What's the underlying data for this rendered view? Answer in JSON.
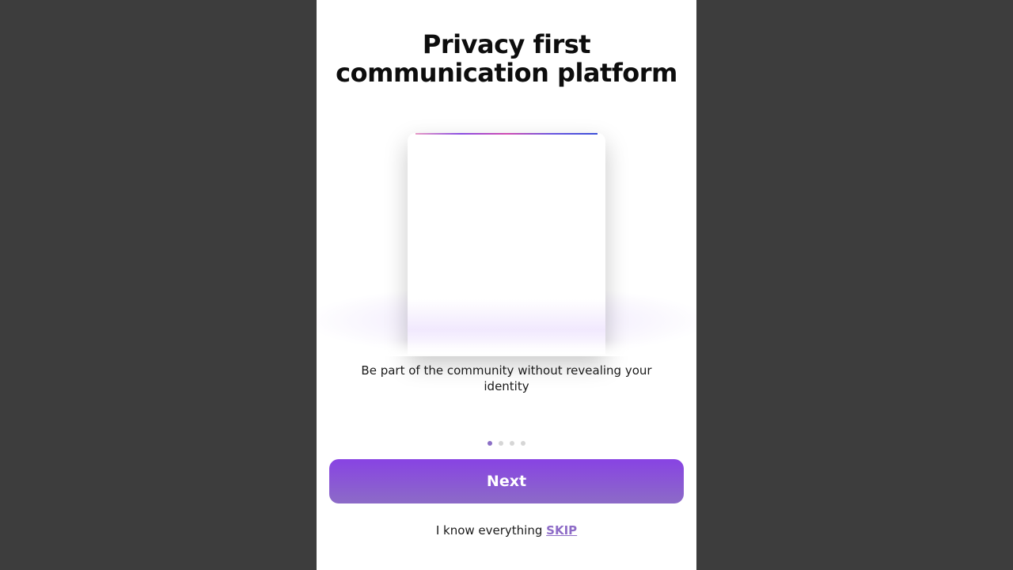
{
  "onboarding": {
    "title_line1": "Privacy first",
    "title_line2": "communication platform",
    "subtitle": "Be part of the community without revealing your identity",
    "pagination": {
      "total": 4,
      "active_index": 0
    },
    "next_label": "Next",
    "skip_prompt": "I know everything",
    "skip_label": "SKIP"
  },
  "colors": {
    "backdrop": "#3d3d3d",
    "accent": "#8843e3",
    "skip_link": "#8e6cc7",
    "dot_active": "#8b6fc6",
    "dot_inactive": "#d6d6d6"
  }
}
